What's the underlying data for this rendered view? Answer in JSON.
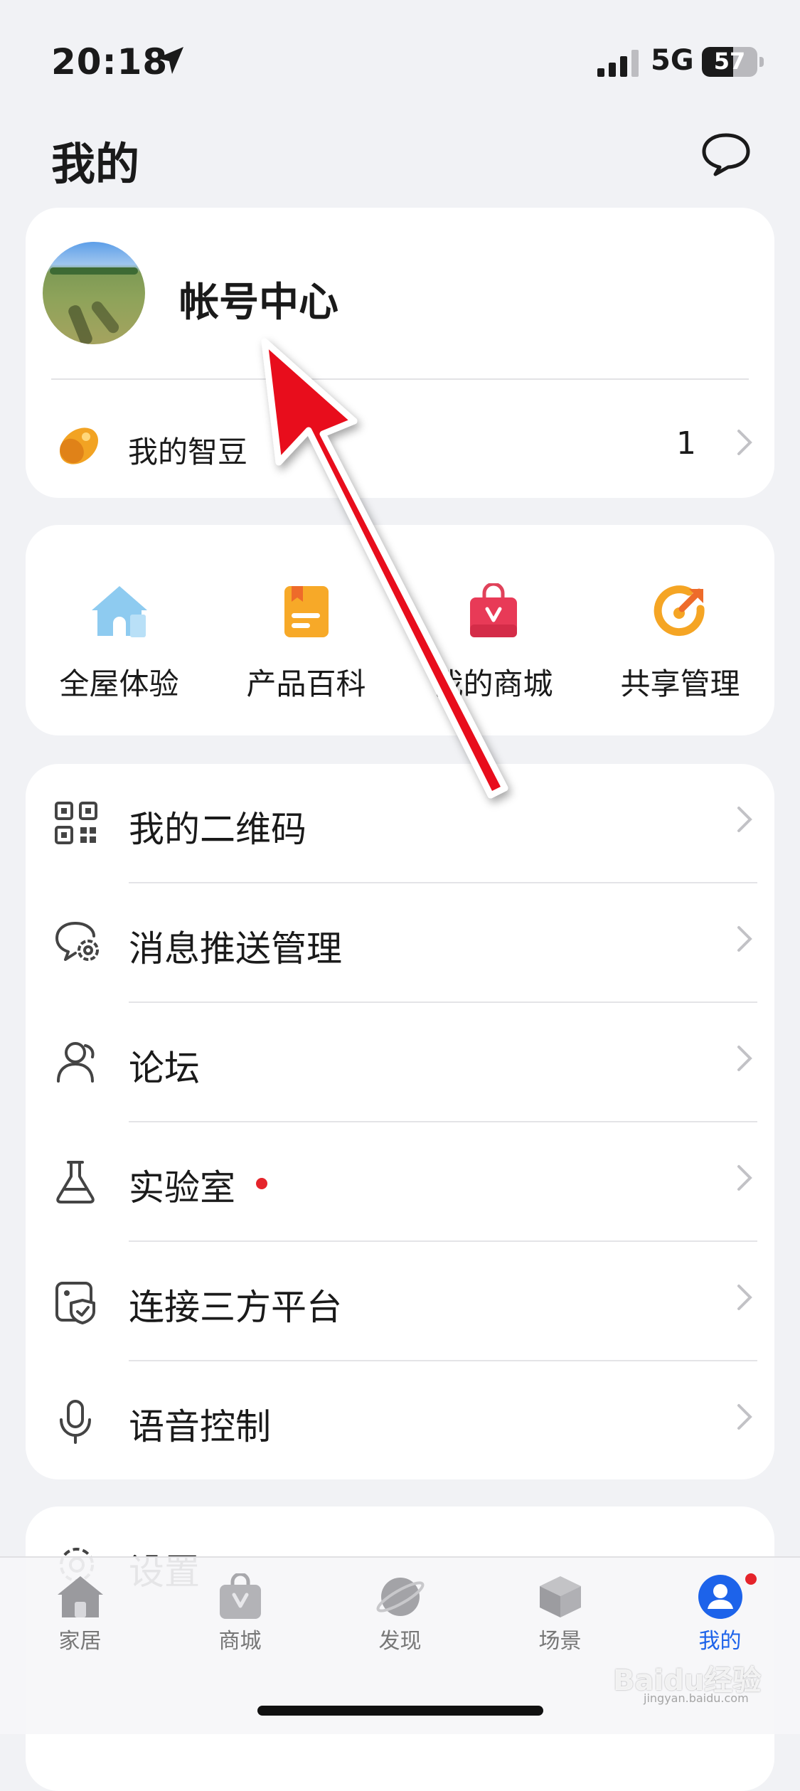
{
  "status_bar": {
    "time": "20:18",
    "network": "5G",
    "battery": "57",
    "battery_level": 0.57
  },
  "header": {
    "title": "我的"
  },
  "account": {
    "name": "帐号中心",
    "beans_label": "我的智豆",
    "beans_count": "1"
  },
  "shortcuts": [
    {
      "label": "全屋体验",
      "icon": "house-icon"
    },
    {
      "label": "产品百科",
      "icon": "book-icon"
    },
    {
      "label": "我的商城",
      "icon": "shopping-bag-icon"
    },
    {
      "label": "共享管理",
      "icon": "share-icon"
    }
  ],
  "menu": [
    {
      "label": "我的二维码",
      "icon": "qr-code-icon"
    },
    {
      "label": "消息推送管理",
      "icon": "message-gear-icon"
    },
    {
      "label": "论坛",
      "icon": "people-icon"
    },
    {
      "label": "实验室",
      "icon": "flask-icon",
      "badge": true
    },
    {
      "label": "连接三方平台",
      "icon": "connect-shield-icon"
    },
    {
      "label": "语音控制",
      "icon": "microphone-icon"
    }
  ],
  "settings": {
    "label": "设置",
    "icon": "gear-icon"
  },
  "tabbar": [
    {
      "label": "家居",
      "icon": "home-icon"
    },
    {
      "label": "商城",
      "icon": "store-bag-icon"
    },
    {
      "label": "发现",
      "icon": "planet-icon"
    },
    {
      "label": "场景",
      "icon": "cube-icon"
    },
    {
      "label": "我的",
      "icon": "user-icon",
      "active": true,
      "badge": true
    }
  ],
  "colors": {
    "accent": "#1d63ea",
    "badge": "#e5242b",
    "annotation_arrow": "#e8111a"
  },
  "watermark": {
    "text": "Baidu经验",
    "sub": "jingyan.baidu.com"
  }
}
